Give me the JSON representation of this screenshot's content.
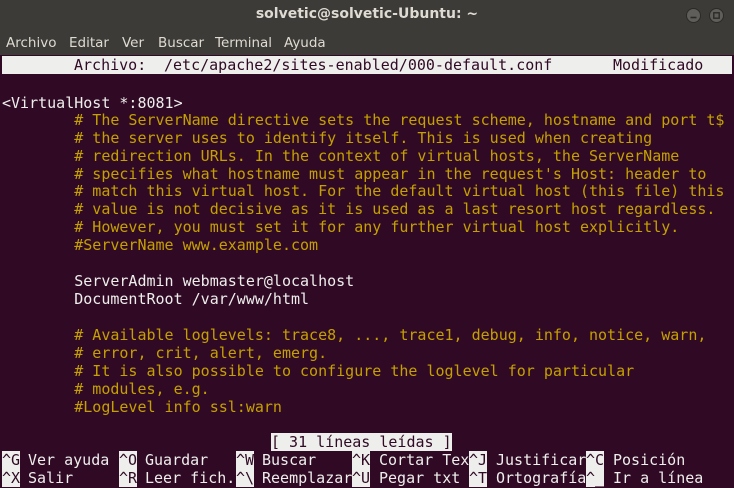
{
  "window": {
    "title": "solvetic@solvetic-Ubuntu: ~",
    "menu": [
      "Archivo",
      "Editar",
      "Ver",
      "Buscar",
      "Terminal",
      "Ayuda"
    ]
  },
  "nano": {
    "header_label": "Archivo:",
    "header_path": "/etc/apache2/sites-enabled/000-default.conf",
    "header_status": "Modificado",
    "lines": [
      {
        "text": "<VirtualHost *:8081>",
        "type": "code"
      },
      {
        "text": "        # The ServerName directive sets the request scheme, hostname and port t$",
        "type": "comment"
      },
      {
        "text": "        # the server uses to identify itself. This is used when creating",
        "type": "comment"
      },
      {
        "text": "        # redirection URLs. In the context of virtual hosts, the ServerName",
        "type": "comment"
      },
      {
        "text": "        # specifies what hostname must appear in the request's Host: header to",
        "type": "comment"
      },
      {
        "text": "        # match this virtual host. For the default virtual host (this file) this",
        "type": "comment"
      },
      {
        "text": "        # value is not decisive as it is used as a last resort host regardless.",
        "type": "comment"
      },
      {
        "text": "        # However, you must set it for any further virtual host explicitly.",
        "type": "comment"
      },
      {
        "text": "        #ServerName www.example.com",
        "type": "comment"
      },
      {
        "text": "",
        "type": "code"
      },
      {
        "text": "        ServerAdmin webmaster@localhost",
        "type": "code"
      },
      {
        "text": "        DocumentRoot /var/www/html",
        "type": "code"
      },
      {
        "text": "",
        "type": "code"
      },
      {
        "text": "        # Available loglevels: trace8, ..., trace1, debug, info, notice, warn,",
        "type": "comment"
      },
      {
        "text": "        # error, crit, alert, emerg.",
        "type": "comment"
      },
      {
        "text": "        # It is also possible to configure the loglevel for particular",
        "type": "comment"
      },
      {
        "text": "        # modules, e.g.",
        "type": "comment"
      },
      {
        "text": "        #LogLevel info ssl:warn",
        "type": "comment"
      }
    ],
    "status_message": "[ 31 líneas leídas ]",
    "shortcuts_row1": [
      {
        "key": "^G",
        "label": "Ver ayuda"
      },
      {
        "key": "^O",
        "label": "Guardar"
      },
      {
        "key": "^W",
        "label": "Buscar"
      },
      {
        "key": "^K",
        "label": "Cortar Tex"
      },
      {
        "key": "^J",
        "label": "Justificar"
      },
      {
        "key": "^C",
        "label": "Posición"
      }
    ],
    "shortcuts_row2": [
      {
        "key": "^X",
        "label": "Salir"
      },
      {
        "key": "^R",
        "label": "Leer fich."
      },
      {
        "key": "^\\",
        "label": "Reemplazar"
      },
      {
        "key": "^U",
        "label": "Pegar txt"
      },
      {
        "key": "^T",
        "label": "Ortografía"
      },
      {
        "key": "^_",
        "label": "Ir a línea"
      }
    ]
  },
  "colors": {
    "terminal_bg": "#300a24",
    "terminal_fg": "#eeeeec",
    "comment": "#c4a000",
    "chrome": "#3c3b37"
  }
}
